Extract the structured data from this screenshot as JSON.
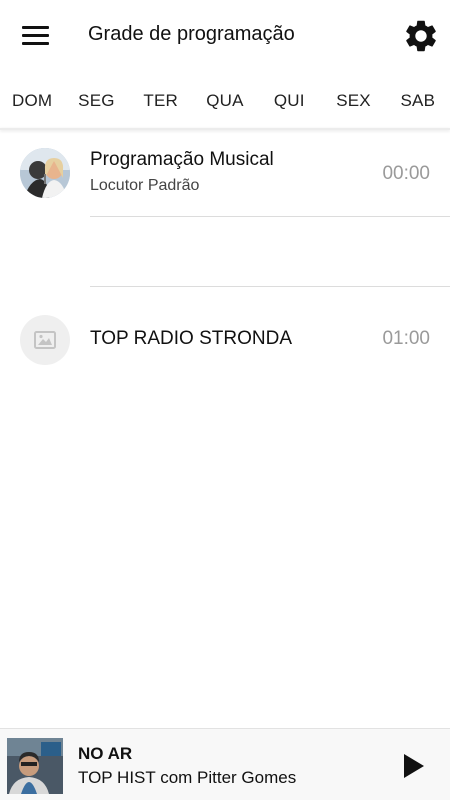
{
  "header": {
    "title": "Grade de programação",
    "menu_icon": "hamburger-menu-icon",
    "settings_icon": "gear-icon"
  },
  "days": {
    "items": [
      "DOM",
      "SEG",
      "TER",
      "QUA",
      "QUI",
      "SEX",
      "SAB"
    ]
  },
  "schedule": {
    "items": [
      {
        "title": "Programação Musical",
        "host": "Locutor Padrão",
        "time": "00:00",
        "avatar": "host-photo"
      },
      {
        "title": "TOP RADIO STRONDA",
        "time": "01:00",
        "avatar": "image-placeholder-icon"
      }
    ]
  },
  "player": {
    "label": "NO AR",
    "show": "TOP HIST com Pitter Gomes",
    "play_icon": "play-icon"
  },
  "colors": {
    "time_text": "#9a9a9a",
    "player_bg": "#f8f8f8",
    "divider": "#dcdcdc"
  }
}
